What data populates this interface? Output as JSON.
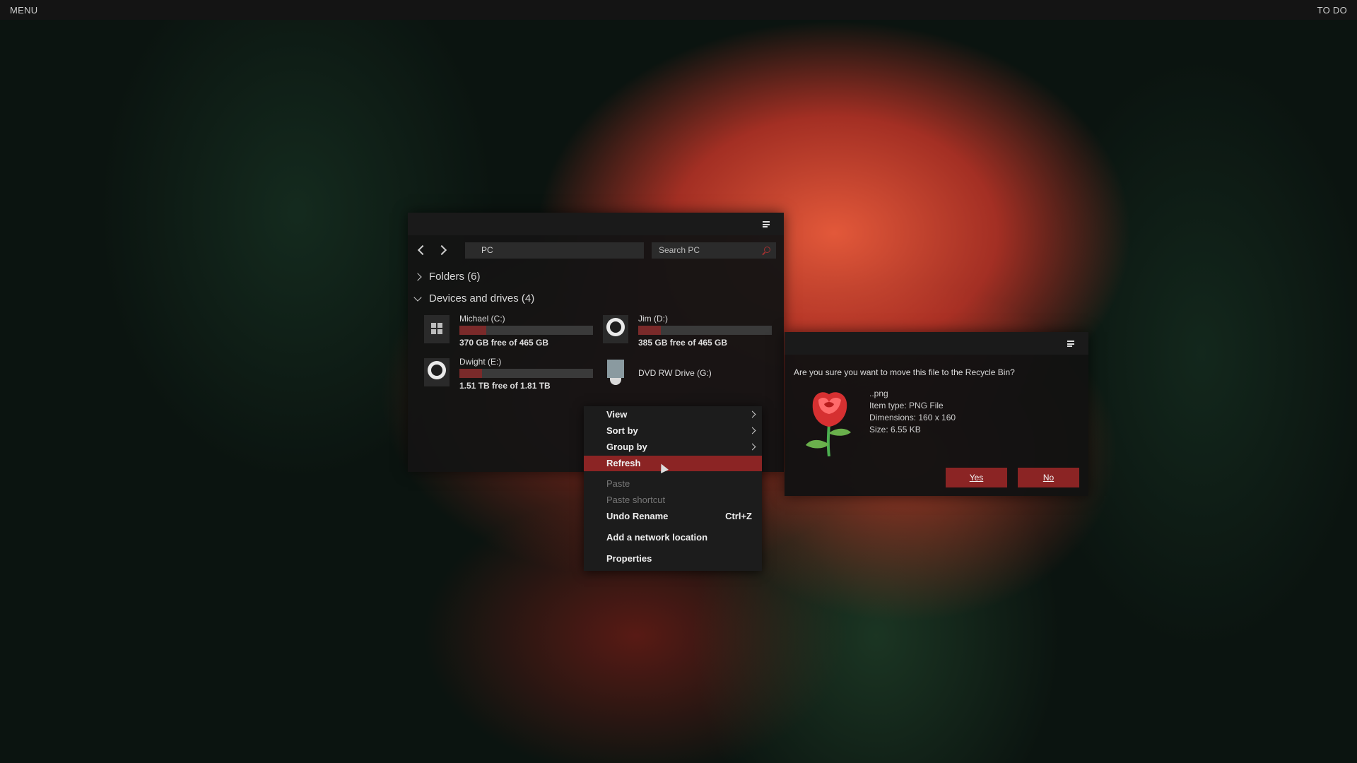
{
  "topbar": {
    "menu_label": "MENU",
    "todo_label": "TO DO"
  },
  "explorer": {
    "address": "PC",
    "search_placeholder": "Search PC",
    "groups": [
      {
        "label": "Folders (6)",
        "expanded": false
      },
      {
        "label": "Devices and drives (4)",
        "expanded": true
      }
    ],
    "drives": [
      {
        "name": "Michael (C:)",
        "free": "370 GB free of 465 GB",
        "used_fraction": 0.2,
        "icon": "windows-logo-icon"
      },
      {
        "name": "Jim (D:)",
        "free": "385 GB free of 465 GB",
        "used_fraction": 0.17,
        "icon": "hard-drive-icon"
      },
      {
        "name": "Dwight (E:)",
        "free": "1.51 TB free of 1.81 TB",
        "used_fraction": 0.17,
        "icon": "hard-drive-icon"
      },
      {
        "name": "DVD RW Drive (G:)",
        "icon": "dvd-drive-icon"
      }
    ]
  },
  "dialog": {
    "question": "Are you sure you want to move this file to the Recycle Bin?",
    "file_name": "..png",
    "item_type": "Item type: PNG File",
    "dimensions": "Dimensions: 160 x 160",
    "size": "Size: 6.55 KB",
    "yes_label": "Yes",
    "no_label": "No"
  },
  "context_menu": {
    "items": [
      {
        "label": "View",
        "submenu": true
      },
      {
        "label": "Sort by",
        "submenu": true
      },
      {
        "label": "Group by",
        "submenu": true
      },
      {
        "label": "Refresh",
        "highlighted": true
      },
      {
        "label": "Paste",
        "disabled": true
      },
      {
        "label": "Paste shortcut",
        "disabled": true
      },
      {
        "label": "Undo Rename",
        "shortcut": "Ctrl+Z"
      },
      {
        "label": "Add a network location"
      },
      {
        "label": "Properties"
      }
    ]
  },
  "colors": {
    "accent": "#8b2424",
    "drive_bar_fill": "#7a2a2a",
    "window_bg": "#141414"
  }
}
